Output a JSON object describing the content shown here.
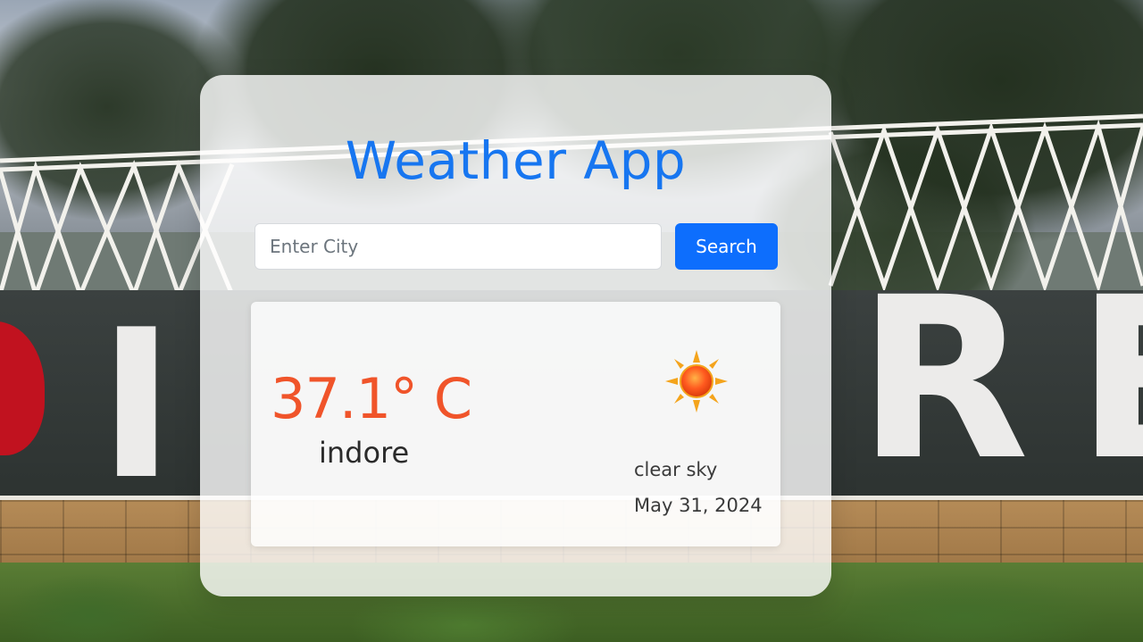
{
  "app": {
    "title": "Weather App"
  },
  "search": {
    "placeholder": "Enter City",
    "value": "",
    "button_label": "Search"
  },
  "weather": {
    "temperature": "37.1° C",
    "city": "indore",
    "condition": "clear sky",
    "date": "May 31, 2024",
    "icon": "sun-icon"
  },
  "colors": {
    "title": "#1776f0",
    "button": "#0d6efd",
    "temperature": "#f0542a"
  }
}
